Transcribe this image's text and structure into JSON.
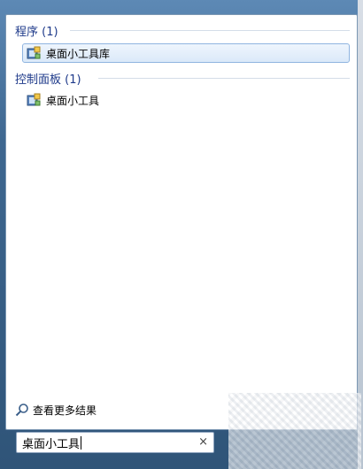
{
  "sections": [
    {
      "header": "程序 (1)",
      "items": [
        {
          "label": "桌面小工具库",
          "selected": true,
          "icon": "gadget-gallery-icon"
        }
      ]
    },
    {
      "header": "控制面板 (1)",
      "items": [
        {
          "label": "桌面小工具",
          "selected": false,
          "icon": "gadget-gallery-icon"
        }
      ]
    }
  ],
  "see_more": {
    "label": "查看更多结果",
    "icon": "search-icon"
  },
  "search": {
    "value": "桌面小工具",
    "clear_label": "×"
  },
  "colors": {
    "header_text": "#1e3a8a",
    "selection_border": "#8fb4e0",
    "frame_blue": "#3e6790"
  }
}
